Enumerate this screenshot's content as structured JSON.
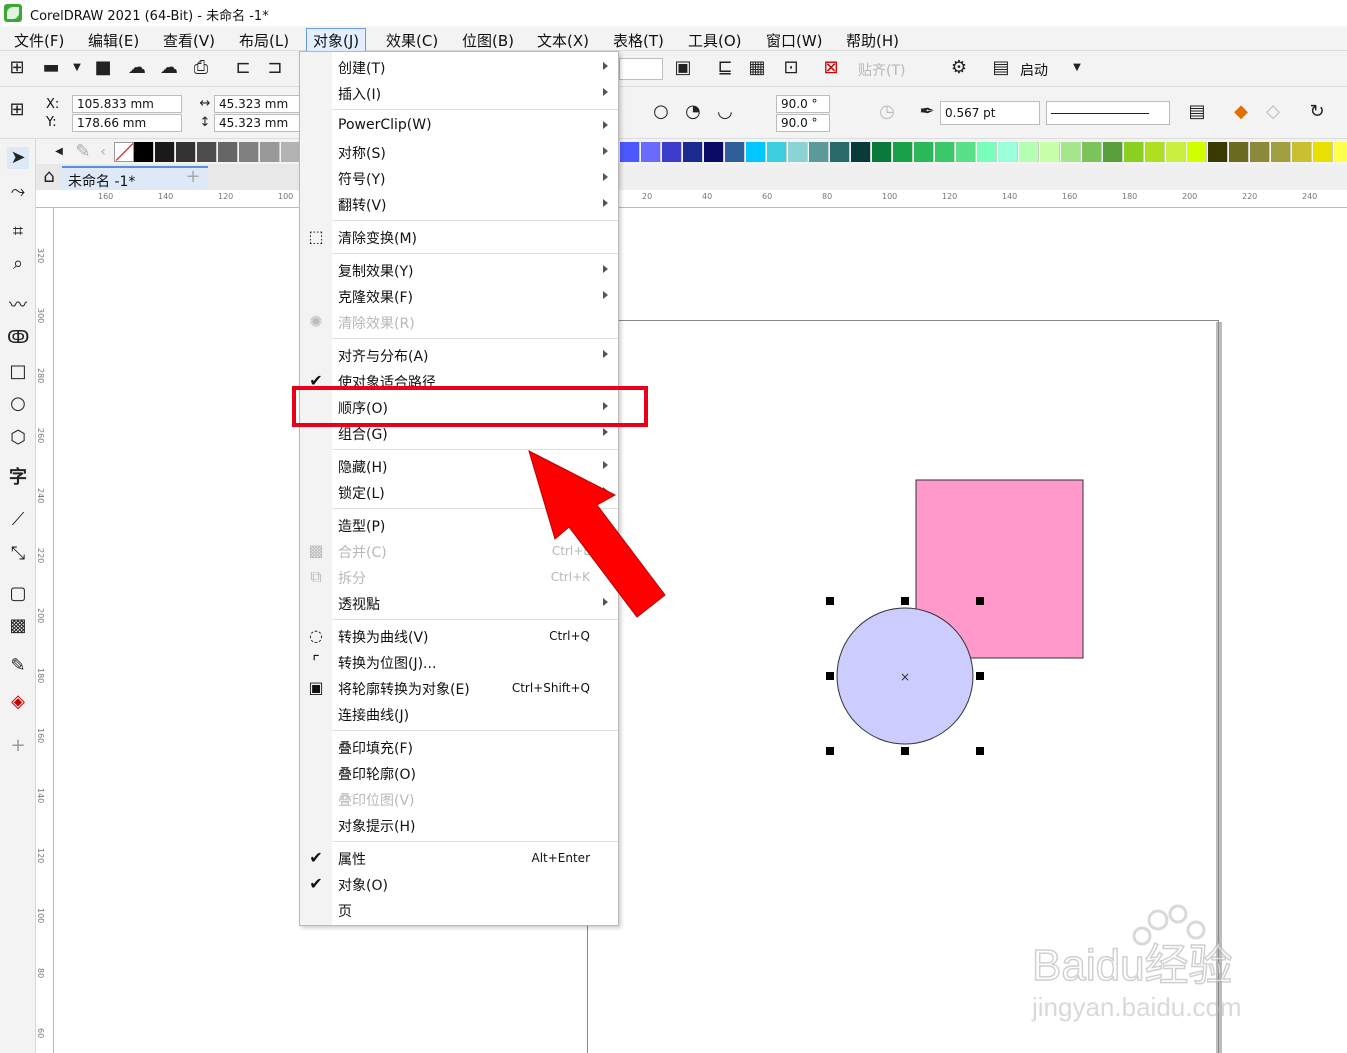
{
  "window": {
    "title": "CorelDRAW 2021 (64-Bit) - 未命名 -1*"
  },
  "menubar": [
    {
      "label": "文件(F)"
    },
    {
      "label": "编辑(E)"
    },
    {
      "label": "查看(V)"
    },
    {
      "label": "布局(L)"
    },
    {
      "label": "对象(J)",
      "active": true
    },
    {
      "label": "效果(C)"
    },
    {
      "label": "位图(B)"
    },
    {
      "label": "文本(X)"
    },
    {
      "label": "表格(T)"
    },
    {
      "label": "工具(O)"
    },
    {
      "label": "窗口(W)"
    },
    {
      "label": "帮助(H)"
    }
  ],
  "toolbar": {
    "snap_label": "贴齐(T)",
    "launch_label": "启动"
  },
  "props": {
    "x_label": "X:",
    "y_label": "Y:",
    "x": "105.833 mm",
    "y": "178.66 mm",
    "w": "45.323 mm",
    "h": "45.323 mm",
    "angle1": "90.0 °",
    "angle2": "90.0 °",
    "outline": "0.567 pt"
  },
  "doc_tab": {
    "label": "未命名 -1*"
  },
  "menu": {
    "items": [
      {
        "label": "创建(T)",
        "sub": true
      },
      {
        "label": "插入(I)",
        "sub": true
      },
      {
        "sep": true
      },
      {
        "label": "PowerClip(W)",
        "sub": true
      },
      {
        "label": "对称(S)",
        "sub": true
      },
      {
        "label": "符号(Y)",
        "sub": true
      },
      {
        "label": "翻转(V)",
        "sub": true
      },
      {
        "sep": true
      },
      {
        "label": "清除变换(M)",
        "icon": "clear-transform-icon"
      },
      {
        "sep": true
      },
      {
        "label": "复制效果(Y)",
        "sub": true
      },
      {
        "label": "克隆效果(F)",
        "sub": true
      },
      {
        "label": "清除效果(R)",
        "disabled": true,
        "icon": "clear-effect-icon"
      },
      {
        "sep": true
      },
      {
        "label": "对齐与分布(A)",
        "sub": true
      },
      {
        "label": "使对象适合路径",
        "check": true
      },
      {
        "label": "顺序(O)",
        "sub": true
      },
      {
        "label": "组合(G)",
        "sub": true
      },
      {
        "sep": true
      },
      {
        "label": "隐藏(H)",
        "sub": true
      },
      {
        "label": "锁定(L)",
        "sub": true
      },
      {
        "sep": true
      },
      {
        "label": "造型(P)",
        "sub": true
      },
      {
        "label": "合并(C)",
        "disabled": true,
        "shortcut": "Ctrl+L",
        "icon": "combine-icon"
      },
      {
        "label": "拆分",
        "disabled": true,
        "shortcut": "Ctrl+K",
        "icon": "break-apart-icon"
      },
      {
        "label": "透视點",
        "sub": true
      },
      {
        "sep": true
      },
      {
        "label": "转换为曲线(V)",
        "shortcut": "Ctrl+Q",
        "icon": "convert-curves-icon"
      },
      {
        "label": "转换为位图(J)...",
        "icon": "convert-bitmap-icon"
      },
      {
        "label": "将轮廓转换为对象(E)",
        "shortcut": "Ctrl+Shift+Q",
        "icon": "outline-to-object-icon"
      },
      {
        "label": "连接曲线(J)"
      },
      {
        "sep": true
      },
      {
        "label": "叠印填充(F)"
      },
      {
        "label": "叠印轮廓(O)"
      },
      {
        "label": "叠印位图(V)",
        "disabled": true
      },
      {
        "label": "对象提示(H)"
      },
      {
        "sep": true
      },
      {
        "label": "属性",
        "check": true,
        "shortcut": "Alt+Enter"
      },
      {
        "label": "对象(O)",
        "check": true
      },
      {
        "label": "页"
      }
    ]
  },
  "palette": {
    "left": [
      "#000000",
      "#1a1a1a",
      "#333333",
      "#4d4d4d",
      "#666666",
      "#808080",
      "#999999",
      "#b3b3b3"
    ],
    "right": [
      "#4d57ff",
      "#6a6aff",
      "#3d3dcc",
      "#1a2a8f",
      "#0a0a66",
      "#2f5f9a",
      "#00c8ff",
      "#3dcfe0",
      "#8ad4d4",
      "#5a9a9a",
      "#2a6a6a",
      "#0a3a3a",
      "#0a7a3a",
      "#1aa04a",
      "#2ab85a",
      "#3ac86a",
      "#5ae08a",
      "#7affba",
      "#9affda",
      "#b5ffb0",
      "#c8ffaa",
      "#a5e68a",
      "#7ac45a",
      "#5aa03a",
      "#8ad020",
      "#aee020",
      "#c8f040",
      "#d0ff00",
      "#3a3a00",
      "#6a6a20",
      "#8a8a3a",
      "#a0a040",
      "#c8c030",
      "#e8e000",
      "#ffff4d",
      "#ffff99"
    ]
  },
  "ruler": {
    "h": [
      "160",
      "140",
      "120",
      "100",
      "20",
      "40",
      "60",
      "80",
      "100",
      "120",
      "140",
      "160",
      "180",
      "200",
      "220",
      "240"
    ],
    "v": [
      "320",
      "300",
      "280",
      "260",
      "240",
      "220",
      "200",
      "180",
      "160",
      "140",
      "120",
      "100",
      "80",
      "60"
    ]
  },
  "shapes": {
    "rect_color": "#ff99cc",
    "circle_color": "#ccccff"
  },
  "highlight": {
    "color": "#e8001a"
  },
  "watermark": {
    "text1": "Baidu经验",
    "text2": "jingyan.baidu.com"
  }
}
